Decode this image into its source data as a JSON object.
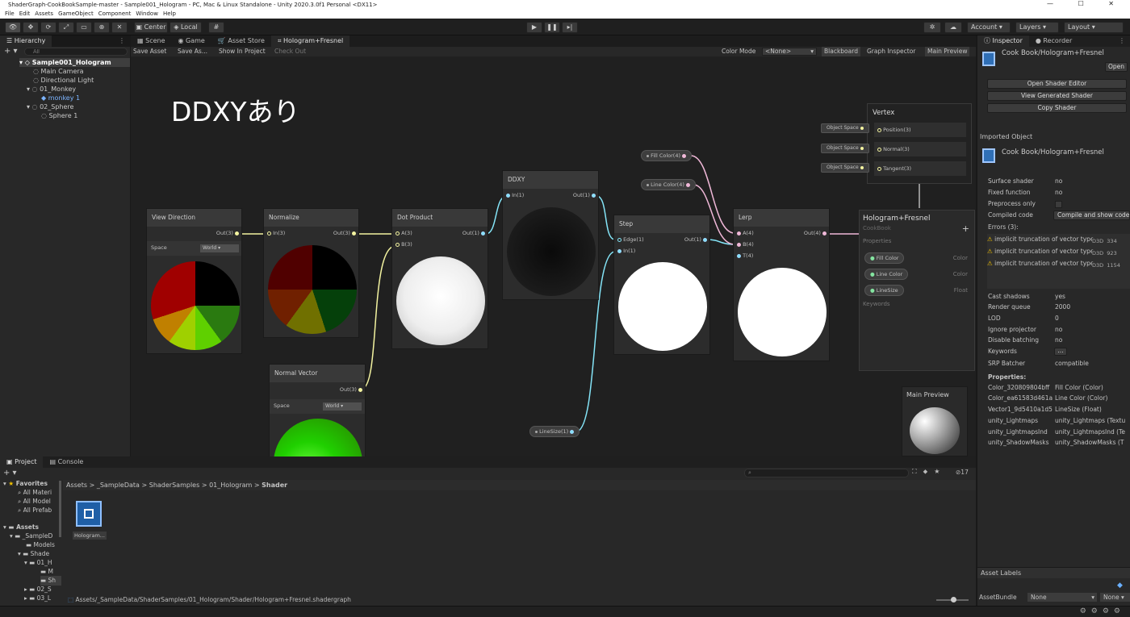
{
  "window": {
    "title": "ShaderGraph-CookBookSample-master - Sample001_Hologram - PC, Mac & Linux Standalone - Unity 2020.3.0f1 Personal <DX11>",
    "controls": "—  ☐  ✕"
  },
  "menu": [
    "File",
    "Edit",
    "Assets",
    "GameObject",
    "Component",
    "Window",
    "Help"
  ],
  "toolbar": {
    "center_label": "Center",
    "local_label": "Local",
    "account": "Account",
    "layers": "Layers",
    "layout": "Layout"
  },
  "hierarchy": {
    "tab": "Hierarchy",
    "search_placeholder": "All",
    "items": [
      {
        "label": "Sample001_Hologram",
        "indent": 0
      },
      {
        "label": "Main Camera",
        "indent": 1
      },
      {
        "label": "Directional Light",
        "indent": 1
      },
      {
        "label": "01_Monkey",
        "indent": 1
      },
      {
        "label": "monkey 1",
        "indent": 2
      },
      {
        "label": "02_Sphere",
        "indent": 1
      },
      {
        "label": "Sphere 1",
        "indent": 2
      }
    ]
  },
  "center_tabs": [
    "Scene",
    "Game",
    "Asset Store",
    "Hologram+Fresnel"
  ],
  "graph_toolbar": {
    "save_asset": "Save Asset",
    "save_as": "Save As...",
    "show_in_project": "Show In Project",
    "check_out": "Check Out",
    "color_mode_label": "Color Mode",
    "color_mode_value": "<None>",
    "blackboard": "Blackboard",
    "graph_inspector": "Graph Inspector",
    "main_preview": "Main Preview"
  },
  "overlay_text": "DDXYあり",
  "nodes": {
    "view_direction": {
      "title": "View Direction",
      "out": "Out(3)",
      "space_label": "Space",
      "space_value": "World"
    },
    "normalize": {
      "title": "Normalize",
      "in": "In(3)",
      "out": "Out(3)"
    },
    "dot_product": {
      "title": "Dot Product",
      "a": "A(3)",
      "b": "B(3)",
      "out": "Out(1)"
    },
    "ddxy": {
      "title": "DDXY",
      "in": "In(1)",
      "out": "Out(1)"
    },
    "step": {
      "title": "Step",
      "edge": "Edge(1)",
      "in": "In(1)",
      "out": "Out(1)"
    },
    "lerp": {
      "title": "Lerp",
      "a": "A(4)",
      "b": "B(4)",
      "t": "T(4)",
      "out": "Out(4)"
    },
    "normal_vector": {
      "title": "Normal Vector",
      "out": "Out(3)",
      "space_label": "Space",
      "space_value": "World"
    },
    "vertex": {
      "title": "Vertex",
      "ports": [
        "Position(3)",
        "Normal(3)",
        "Tangent(3)"
      ],
      "space": "Object Space"
    },
    "fill_color": "Fill Color(4)",
    "line_color": "Line Color(4)",
    "line_size": "LineSize(1)"
  },
  "blackboard": {
    "title": "Hologram+Fresnel",
    "subtitle": "CookBook",
    "properties_label": "Properties",
    "keywords_label": "Keywords",
    "items": [
      {
        "name": "Fill Color",
        "type": "Color"
      },
      {
        "name": "Line Color",
        "type": "Color"
      },
      {
        "name": "LineSize",
        "type": "Float"
      }
    ]
  },
  "main_preview_label": "Main Preview",
  "inspector": {
    "tabs": [
      "Inspector",
      "Recorder"
    ],
    "path": "Cook Book/Hologram+Fresnel",
    "open": "Open",
    "buttons": [
      "Open Shader Editor",
      "View Generated Shader",
      "Copy Shader"
    ],
    "imported_object": "Imported Object",
    "imported_path": "Cook Book/Hologram+Fresnel",
    "rows1": [
      {
        "k": "Surface shader",
        "v": "no"
      },
      {
        "k": "Fixed function",
        "v": "no"
      },
      {
        "k": "Preprocess only",
        "v": ""
      },
      {
        "k": "Compiled code",
        "v": "Compile and show code"
      }
    ],
    "errors_label": "Errors (3):",
    "errors": [
      {
        "msg": "implicit truncation of vector type",
        "api": "D3D",
        "line": "334"
      },
      {
        "msg": "implicit truncation of vector type",
        "api": "D3D",
        "line": "923"
      },
      {
        "msg": "implicit truncation of vector type",
        "api": "D3D",
        "line": "1154"
      }
    ],
    "rows2": [
      {
        "k": "Cast shadows",
        "v": "yes"
      },
      {
        "k": "Render queue",
        "v": "2000"
      },
      {
        "k": "LOD",
        "v": "0"
      },
      {
        "k": "Ignore projector",
        "v": "no"
      },
      {
        "k": "Disable batching",
        "v": "no"
      },
      {
        "k": "Keywords",
        "v": "..."
      },
      {
        "k": "SRP Batcher",
        "v": "compatible"
      }
    ],
    "properties_label": "Properties:",
    "properties": [
      {
        "k": "Color_320809804bff",
        "v": "Fill Color (Color)"
      },
      {
        "k": "Color_ea61583d461a",
        "v": "Line Color (Color)"
      },
      {
        "k": "Vector1_9d5410a1d5",
        "v": "LineSize (Float)"
      },
      {
        "k": "unity_Lightmaps",
        "v": "unity_Lightmaps (Textu"
      },
      {
        "k": "unity_LightmapsInd",
        "v": "unity_LightmapsInd (Te"
      },
      {
        "k": "unity_ShadowMasks",
        "v": "unity_ShadowMasks (T"
      }
    ],
    "asset_labels": "Asset Labels",
    "asset_bundle_label": "AssetBundle",
    "asset_bundle_value": "None",
    "asset_bundle_variant": "None"
  },
  "project": {
    "tabs": [
      "Project",
      "Console"
    ],
    "breadcrumb": [
      "Assets",
      ">",
      "_SampleData",
      ">",
      "ShaderSamples",
      ">",
      "01_Hologram",
      ">",
      "Shader"
    ],
    "favorites_label": "Favorites",
    "favorites": [
      "All Materi",
      "All Model",
      "All Prefab"
    ],
    "assets_label": "Assets",
    "tree": [
      "_SampleD",
      "Models",
      "Shade",
      "01_H",
      "M",
      "Sh",
      "02_S",
      "03_L"
    ],
    "file_label": "Hologram...",
    "status_path": "Assets/_SampleData/ShaderSamples/01_Hologram/Shader/Hologram+Fresnel.shadergraph",
    "hidden_count": "17"
  }
}
